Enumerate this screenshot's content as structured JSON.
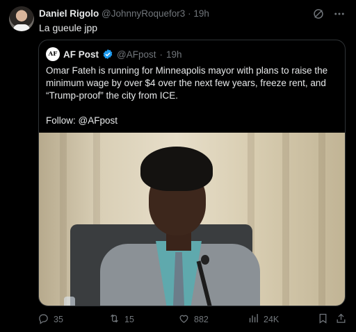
{
  "tweet": {
    "author_name": "Daniel Rigolo",
    "handle": "@JohnnyRoquefor3",
    "separator": "·",
    "time": "19h",
    "text": "La gueule jpp"
  },
  "quote": {
    "avatar_text": "AF",
    "author_name": "AF Post",
    "handle": "@AFpost",
    "separator": "·",
    "time": "19h",
    "body": "Omar Fateh is running for Minneapolis mayor with plans to raise the minimum wage by over $4 over the next few years, freeze rent, and “Trump-proof” the city from ICE.",
    "follow": "Follow: @AFpost"
  },
  "actions": {
    "replies": "35",
    "reposts": "15",
    "likes": "882",
    "views": "24K"
  },
  "colors": {
    "background": "#000000",
    "text": "#e7e9ea",
    "muted": "#71767b",
    "verified": "#1d9bf0",
    "border": "#2f3336"
  },
  "icons": [
    "grok-icon",
    "more-icon",
    "verified-badge-icon",
    "reply-icon",
    "repost-icon",
    "like-icon",
    "views-icon",
    "bookmark-icon",
    "share-icon"
  ]
}
